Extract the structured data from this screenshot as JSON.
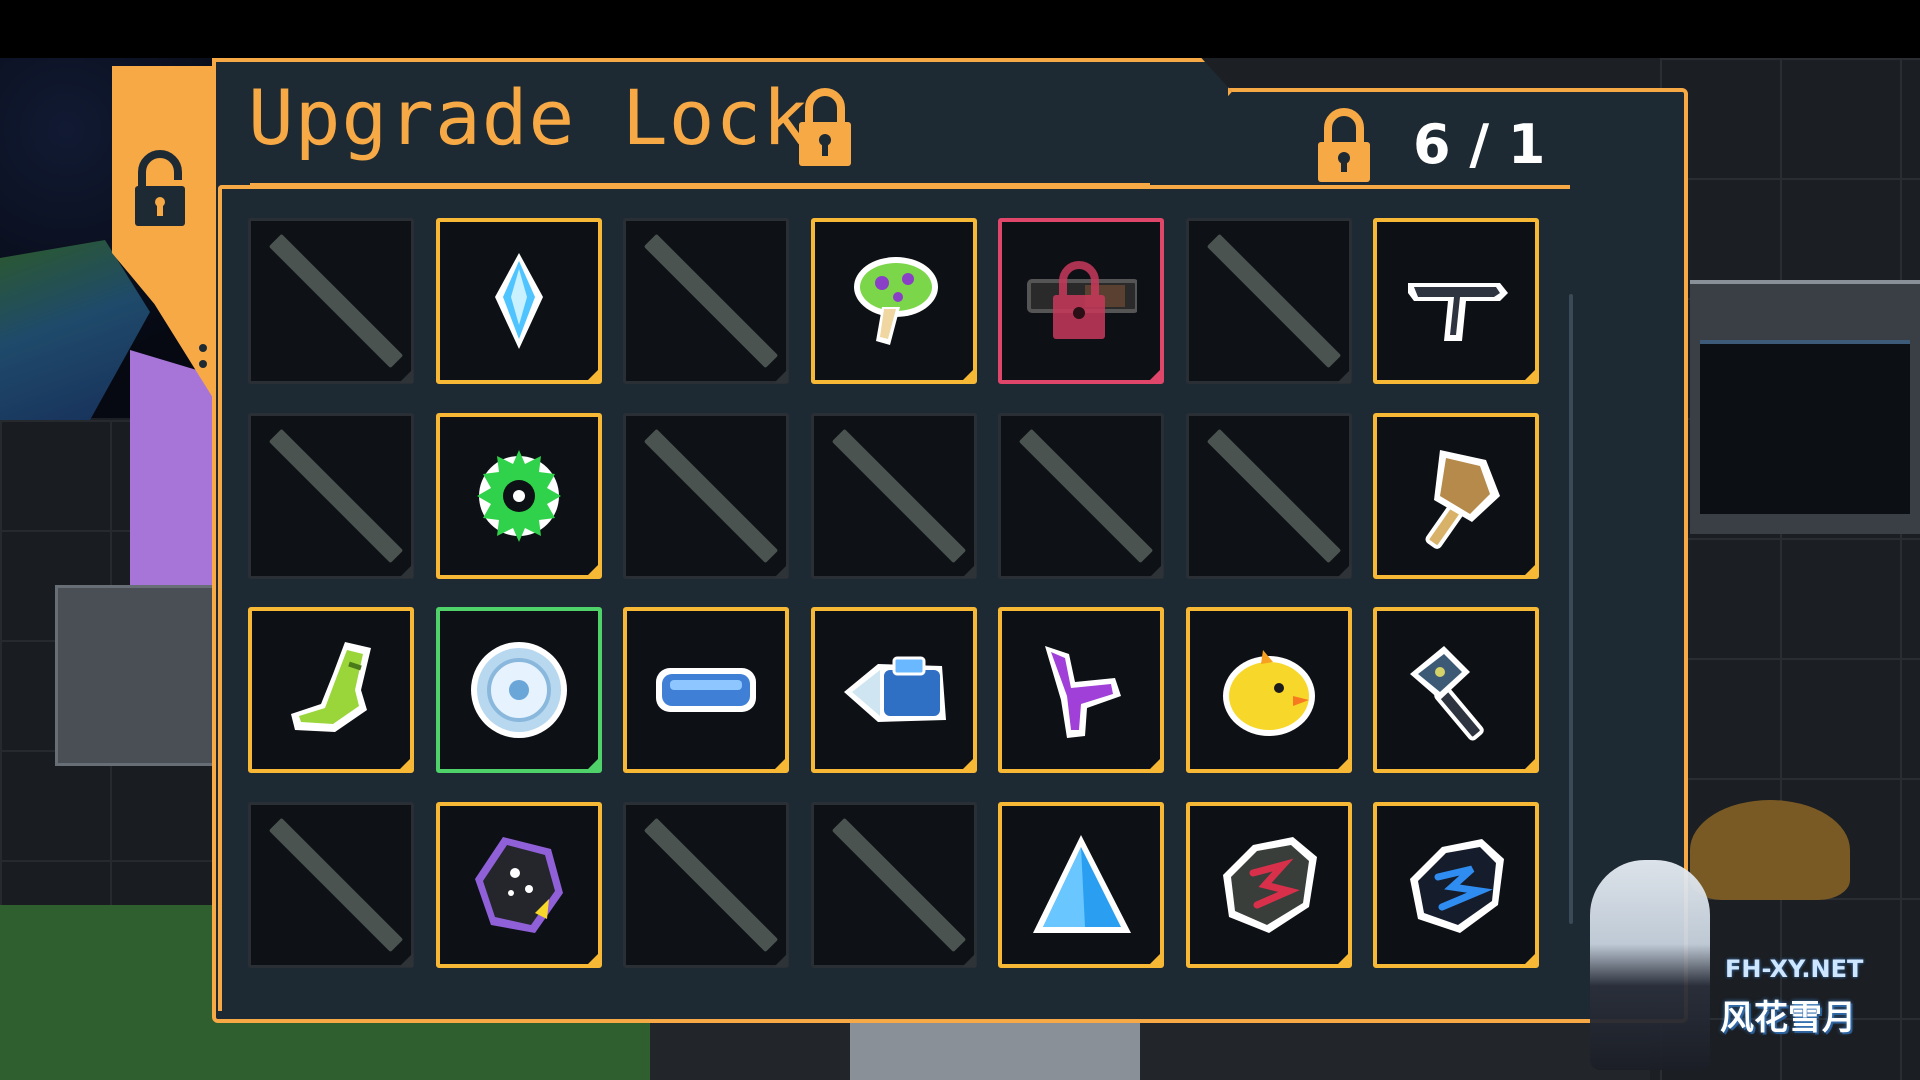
{
  "dialog": {
    "title": "Upgrade Lock",
    "count": "6 / 1",
    "colors": {
      "accent": "#f7a945",
      "slot_border": "#f7b835",
      "locked_border": "#e0456a",
      "selected_border": "#4fd26a",
      "panel_bg": "#1e2a33"
    }
  },
  "watermark": {
    "domain": "FH-XY.NET",
    "name": "风花雪月"
  },
  "slots": [
    {
      "row": 1,
      "col": 1,
      "state": "empty",
      "icon": "empty-slot-icon"
    },
    {
      "row": 1,
      "col": 2,
      "state": "filled",
      "icon": "blue-crystal-icon"
    },
    {
      "row": 1,
      "col": 3,
      "state": "empty",
      "icon": "empty-slot-icon"
    },
    {
      "row": 1,
      "col": 4,
      "state": "filled",
      "icon": "green-mushroom-icon"
    },
    {
      "row": 1,
      "col": 5,
      "state": "locked",
      "icon": "locked-cannon-icon"
    },
    {
      "row": 1,
      "col": 6,
      "state": "empty",
      "icon": "empty-slot-icon"
    },
    {
      "row": 1,
      "col": 7,
      "state": "filled",
      "icon": "smg-icon"
    },
    {
      "row": 2,
      "col": 1,
      "state": "empty",
      "icon": "empty-slot-icon"
    },
    {
      "row": 2,
      "col": 2,
      "state": "filled",
      "icon": "green-virus-icon"
    },
    {
      "row": 2,
      "col": 3,
      "state": "empty",
      "icon": "empty-slot-icon"
    },
    {
      "row": 2,
      "col": 4,
      "state": "empty",
      "icon": "empty-slot-icon"
    },
    {
      "row": 2,
      "col": 5,
      "state": "empty",
      "icon": "empty-slot-icon"
    },
    {
      "row": 2,
      "col": 6,
      "state": "empty",
      "icon": "empty-slot-icon"
    },
    {
      "row": 2,
      "col": 7,
      "state": "filled",
      "icon": "battle-axe-icon"
    },
    {
      "row": 3,
      "col": 1,
      "state": "filled",
      "icon": "green-boot-icon"
    },
    {
      "row": 3,
      "col": 2,
      "state": "selected",
      "icon": "shield-disc-icon"
    },
    {
      "row": 3,
      "col": 3,
      "state": "filled",
      "icon": "blue-capsule-icon"
    },
    {
      "row": 3,
      "col": 4,
      "state": "filled",
      "icon": "blue-drill-icon"
    },
    {
      "row": 3,
      "col": 5,
      "state": "filled",
      "icon": "purple-claw-icon"
    },
    {
      "row": 3,
      "col": 6,
      "state": "filled",
      "icon": "yellow-chick-icon"
    },
    {
      "row": 3,
      "col": 7,
      "state": "filled",
      "icon": "war-hammer-icon"
    },
    {
      "row": 4,
      "col": 1,
      "state": "empty",
      "icon": "empty-slot-icon"
    },
    {
      "row": 4,
      "col": 2,
      "state": "filled",
      "icon": "dark-stone-icon"
    },
    {
      "row": 4,
      "col": 3,
      "state": "empty",
      "icon": "empty-slot-icon"
    },
    {
      "row": 4,
      "col": 4,
      "state": "empty",
      "icon": "empty-slot-icon"
    },
    {
      "row": 4,
      "col": 5,
      "state": "filled",
      "icon": "blue-pyramid-icon"
    },
    {
      "row": 4,
      "col": 6,
      "state": "filled",
      "icon": "red-rune-stone-icon"
    },
    {
      "row": 4,
      "col": 7,
      "state": "filled",
      "icon": "blue-rune-stone-icon"
    }
  ]
}
